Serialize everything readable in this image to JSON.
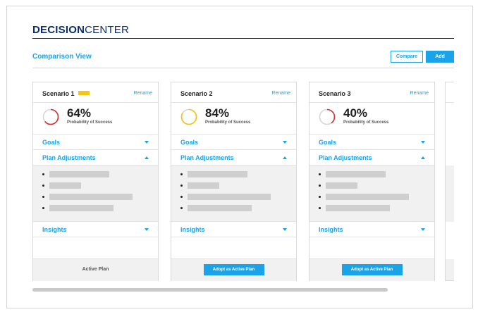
{
  "brand": {
    "bold": "DECISION",
    "light": "CENTER"
  },
  "view": {
    "title": "Comparison View"
  },
  "toolbar": {
    "compare_label": "Compare",
    "add_label": "Add"
  },
  "colors": {
    "accent": "#1aa3e8",
    "brand": "#0b2d6b",
    "badge": "#f5c518",
    "ring_red": "#d0302f",
    "ring_yellow": "#f2c315"
  },
  "scenarios": [
    {
      "name": "Scenario 1",
      "has_badge": true,
      "rename_label": "Rename",
      "probability": 0.64,
      "pct_text": "64%",
      "ring_color": "#d0302f",
      "prob_label": "Probability of Success",
      "goals_label": "Goals",
      "plan_label": "Plan Adjustments",
      "insights_label": "Insights",
      "footer_label": "Active Plan",
      "is_active": true
    },
    {
      "name": "Scenario 2",
      "has_badge": false,
      "rename_label": "Rename",
      "probability": 0.84,
      "pct_text": "84%",
      "ring_color": "#f2c315",
      "prob_label": "Probability of Success",
      "goals_label": "Goals",
      "plan_label": "Plan Adjustments",
      "insights_label": "Insights",
      "footer_label": "Adopt as Active Plan",
      "is_active": false
    },
    {
      "name": "Scenario 3",
      "has_badge": false,
      "rename_label": "Rename",
      "probability": 0.4,
      "pct_text": "40%",
      "ring_color": "#d0302f",
      "prob_label": "Probability of Success",
      "goals_label": "Goals",
      "plan_label": "Plan Adjustments",
      "insights_label": "Insights",
      "footer_label": "Adopt as Active Plan",
      "is_active": false
    }
  ]
}
